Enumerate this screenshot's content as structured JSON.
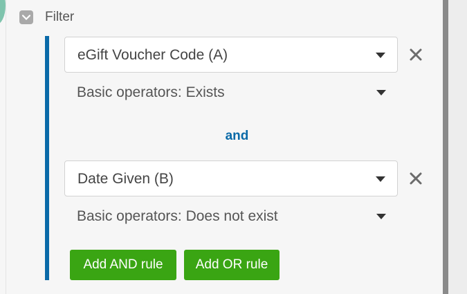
{
  "filter": {
    "label": "Filter",
    "checked": true
  },
  "rules": [
    {
      "field": "eGift Voucher Code (A)",
      "operator": "Basic operators: Exists"
    },
    {
      "field": "Date Given (B)",
      "operator": "Basic operators: Does not exist"
    }
  ],
  "connector_label": "and",
  "buttons": {
    "add_and": "Add AND rule",
    "add_or": "Add OR rule"
  },
  "colors": {
    "accent_blue": "#0a6aa8",
    "button_green": "#3aa513"
  },
  "icons": {
    "remove": "close-icon",
    "dropdown": "chevron-down-icon",
    "checkbox": "checkbox-icon"
  }
}
